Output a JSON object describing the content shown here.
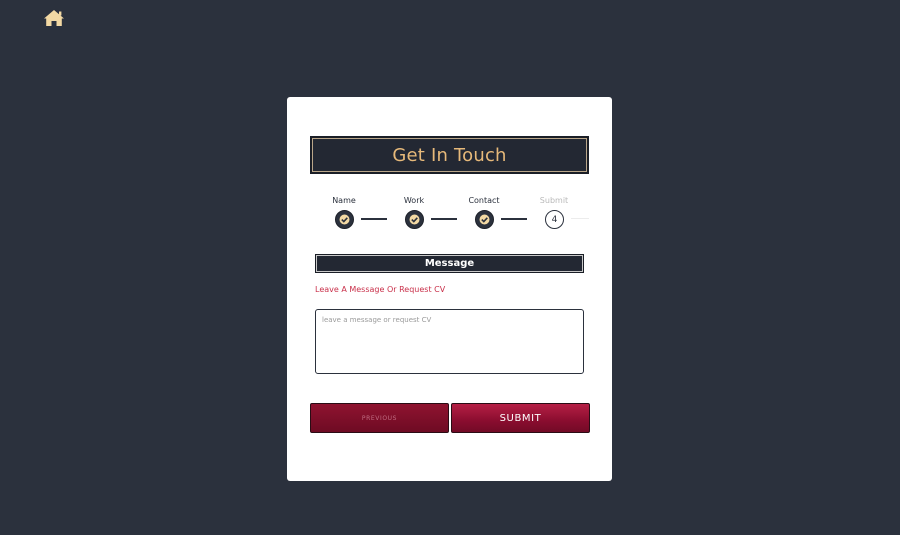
{
  "nav": {
    "home_icon": "home-icon"
  },
  "form": {
    "title": "Get In Touch",
    "steps": [
      {
        "label": "Name",
        "state": "done"
      },
      {
        "label": "Work",
        "state": "done"
      },
      {
        "label": "Contact",
        "state": "done"
      },
      {
        "label": "Submit",
        "state": "current",
        "number": "4"
      }
    ],
    "section_title": "Message",
    "hint": "Leave A Message Or Request CV",
    "message_placeholder": "leave a message or request CV",
    "message_value": "",
    "previous_label": "PREVIOUS",
    "submit_label": "SUBMIT"
  },
  "colors": {
    "background": "#2b313d",
    "accent_gold": "#e6b97a",
    "button_red": "#8a0d2f",
    "hint_red": "#c9304a"
  }
}
